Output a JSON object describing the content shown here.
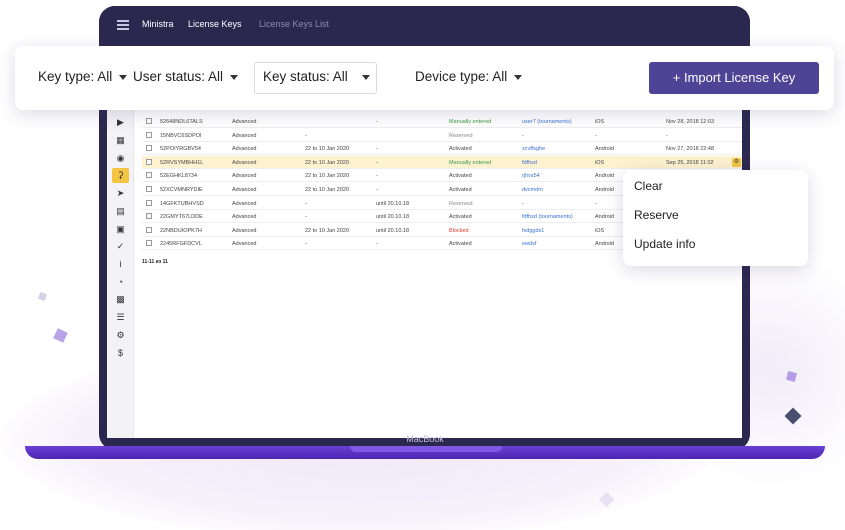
{
  "app": {
    "crumbs": [
      "Ministra",
      "License Keys",
      "License Keys List"
    ]
  },
  "filters": {
    "key_type": "Key type: All",
    "user_status": "User status: All",
    "key_status": "Key status: All",
    "device_type": "Device type: All",
    "import_button": "+ Import License Key"
  },
  "table": {
    "rows": [
      {
        "key": "52648NDL6TALS",
        "type": "Advanced",
        "period": "",
        "until": "-",
        "status": "Manually entered",
        "device": "user7 (tournaments)",
        "os": "iOS",
        "date": "Nov 28, 2018 12:03",
        "status_kind": "green"
      },
      {
        "key": "15NBVC6SDPOI",
        "type": "Advanced",
        "period": "-",
        "until": "",
        "status": "Reserved",
        "device": "-",
        "os": "-",
        "date": "-",
        "status_kind": "grey"
      },
      {
        "key": "52POIYRGBV54",
        "type": "Advanced",
        "period": "22 to 10 Jan 2020",
        "until": "-",
        "status": "Activated",
        "device": "xcvffsghe",
        "os": "Android",
        "date": "Nov 27, 2018 22:48",
        "status_kind": "normal"
      },
      {
        "key": "52RVSYMBHH1L",
        "type": "Advanced",
        "period": "22 to 10 Jan 2020",
        "until": "-",
        "status": "Manually entered",
        "device": "fdfhsd",
        "os": "iOS",
        "date": "Sep 25, 2018 11:02",
        "status_kind": "green"
      },
      {
        "key": "52EGHKL8734",
        "type": "Advanced",
        "period": "22 to 10 Jan 2020",
        "until": "-",
        "status": "Activated",
        "device": "rjhvs54",
        "os": "Android",
        "date": "",
        "status_kind": "normal"
      },
      {
        "key": "52XCVMNRYDIE",
        "type": "Advanced",
        "period": "22 to 10 Jan 2020",
        "until": "-",
        "status": "Activated",
        "device": "dvcmdm",
        "os": "Android",
        "date": "",
        "status_kind": "normal"
      },
      {
        "key": "14GFKTUBHVSD",
        "type": "Advanced",
        "period": "-",
        "until": "until 20.10.18",
        "status": "Reserved",
        "device": "-",
        "os": "-",
        "date": "",
        "status_kind": "grey"
      },
      {
        "key": "22GMYT67LDDE",
        "type": "Advanced",
        "period": "-",
        "until": "until 20.10.18",
        "status": "Activated",
        "device": "fdfhsd (tournaments)",
        "os": "Android",
        "date": "",
        "status_kind": "normal"
      },
      {
        "key": "22NBDUIOPK7H",
        "type": "Advanced",
        "period": "22 to 10 Jan 2020",
        "until": "until 20.10.18",
        "status": "Blocked",
        "device": "fsdggds1",
        "os": "iOS",
        "date": "",
        "status_kind": "red"
      },
      {
        "key": "2245RFGFDCVL",
        "type": "Advanced",
        "period": "-",
        "until": "-",
        "status": "Activated",
        "device": "ewdsf",
        "os": "Android",
        "date": "",
        "status_kind": "normal"
      }
    ],
    "pager": "11-11 из 11"
  },
  "context_menu": {
    "items": [
      "Clear",
      "Reserve",
      "Update info"
    ]
  },
  "laptop_brand": "MacBook",
  "sidebar_icons": [
    "megaphone-icon",
    "calculator-icon",
    "users-icon",
    "key-icon",
    "rocket-icon",
    "calendar-icon",
    "lock-icon",
    "check-icon",
    "info-icon",
    "pie-chart-icon",
    "archive-icon",
    "list-icon",
    "cogs-icon",
    "dollar-icon"
  ],
  "colors": {
    "accent": "#4f4396",
    "laptop": "#2b2850",
    "highlight": "#f4c542"
  }
}
